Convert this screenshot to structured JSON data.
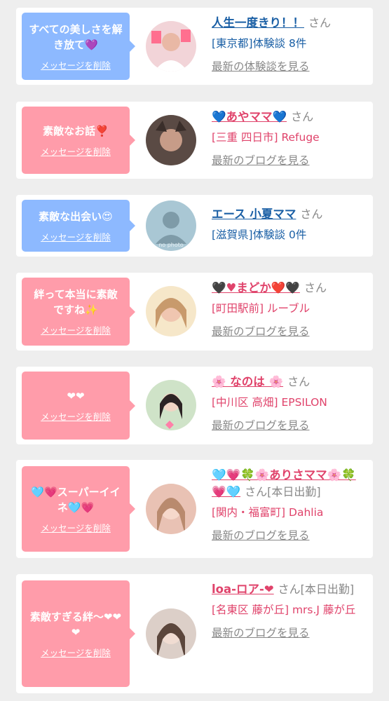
{
  "items": [
    {
      "message": "すべての美しさを解き放て💜",
      "delete_label": "メッセージを削除",
      "bubble_color": "#8db9ff",
      "user_name": "人生一度きり！！",
      "honorific": "さん",
      "subtitle": "[東京都]体験談 8件",
      "link_label": "最新の体験談を見る",
      "text_color": "#1a5fa5",
      "avatar_icon": "avatar-photo"
    },
    {
      "message": "素敵なお話❣️",
      "delete_label": "メッセージを削除",
      "bubble_color": "#ff9caa",
      "user_name": "💙あやママ💙",
      "honorific": "さん",
      "subtitle": "[三重 四日市] Refuge",
      "link_label": "最新のブログを見る",
      "text_color": "#e0436b",
      "avatar_icon": "avatar-photo"
    },
    {
      "message": "素敵な出会い😍",
      "delete_label": "メッセージを削除",
      "bubble_color": "#8db9ff",
      "user_name": "エース 小夏ママ",
      "honorific": "さん",
      "subtitle": "[滋賀県]体験談 0件",
      "link_label": "",
      "text_color": "#1a5fa5",
      "avatar_icon": "no-photo-icon",
      "avatar_caption": "no photo"
    },
    {
      "message": "絆って本当に素敵ですね✨",
      "delete_label": "メッセージを削除",
      "bubble_color": "#ff9caa",
      "user_name": "🖤♥まどか❤️🖤",
      "honorific": "さん",
      "subtitle": "[町田駅前] ルーブル",
      "link_label": "最新のブログを見る",
      "text_color": "#e0436b",
      "avatar_icon": "avatar-photo"
    },
    {
      "message": "❤❤",
      "delete_label": "メッセージを削除",
      "bubble_color": "#ff9caa",
      "user_name": "🌸 なのは 🌸",
      "honorific": "さん",
      "subtitle": "[中川区 高畑] EPSILON",
      "link_label": "最新のブログを見る",
      "text_color": "#e0436b",
      "avatar_icon": "avatar-photo"
    },
    {
      "message": "🩵💗スーパーイイネ🩵💗",
      "delete_label": "メッセージを削除",
      "bubble_color": "#ff9caa",
      "user_name": "🩵💗🍀🌸ありさママ🌸🍀💗🩵",
      "honorific": "さん[本日出勤]",
      "subtitle": "[関内・福富町] Dahlia",
      "link_label": "最新のブログを見る",
      "text_color": "#e0436b",
      "avatar_icon": "avatar-photo"
    },
    {
      "message": "素敵すぎる絆〜❤❤❤",
      "delete_label": "メッセージを削除",
      "bubble_color": "#ff9caa",
      "user_name": "loa-ロア-❤",
      "honorific": "さん[本日出勤]",
      "subtitle": "[名東区 藤が丘] mrs.J 藤が丘",
      "link_label": "最新のブログを見る",
      "text_color": "#e0436b",
      "avatar_icon": "avatar-photo"
    }
  ]
}
